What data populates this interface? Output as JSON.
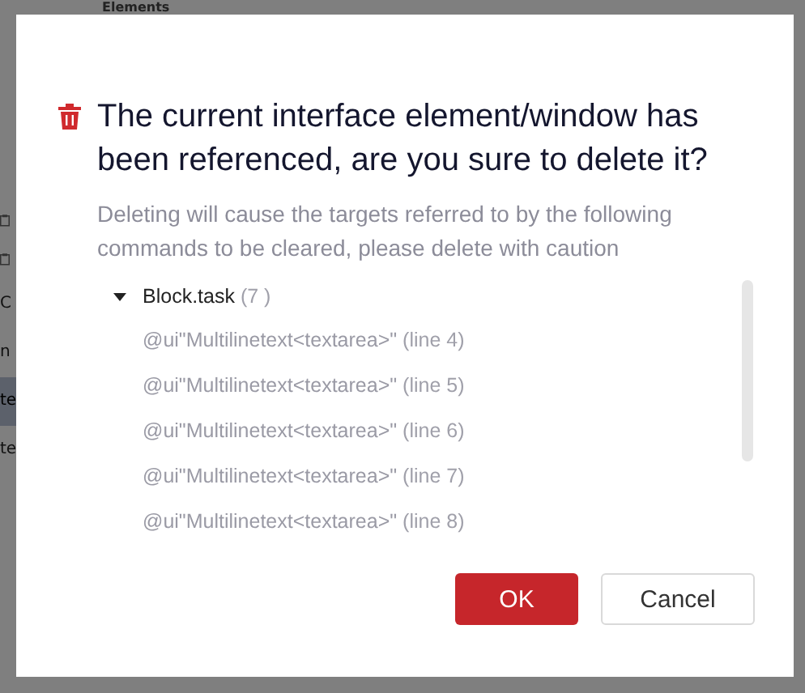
{
  "background": {
    "panel_title": "Elements",
    "fragments": [
      {
        "text": "C",
        "selected": false
      },
      {
        "text": "n",
        "selected": false
      },
      {
        "text": "te",
        "selected": true
      },
      {
        "text": "te",
        "selected": false
      }
    ]
  },
  "dialog": {
    "title": "The current interface element/window has been referenced, are you sure to delete it?",
    "message": "Deleting will cause the targets referred to by the following commands to be cleared, please delete with caution",
    "tree": [
      {
        "label": "Block.task",
        "count": "(7 )",
        "expanded": true,
        "children": [
          {
            "label": "@ui\"Multilinetext<textarea>\"",
            "line": "(line 4)"
          },
          {
            "label": "@ui\"Multilinetext<textarea>\"",
            "line": "(line 5)"
          },
          {
            "label": "@ui\"Multilinetext<textarea>\"",
            "line": "(line 6)"
          },
          {
            "label": "@ui\"Multilinetext<textarea>\"",
            "line": "(line 7)"
          },
          {
            "label": "@ui\"Multilinetext<textarea>\"",
            "line": "(line 8)"
          }
        ]
      }
    ],
    "buttons": [
      {
        "label": "OK",
        "kind": "primary"
      },
      {
        "label": "Cancel",
        "kind": "secondary"
      }
    ]
  }
}
